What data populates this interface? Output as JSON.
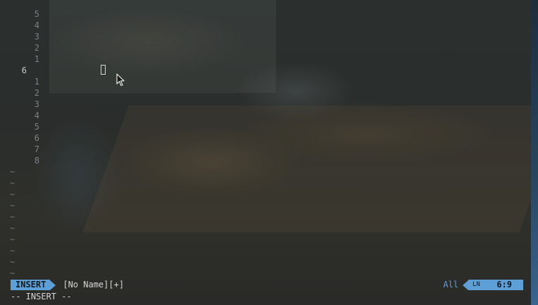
{
  "editor": {
    "line_numbers_above": [
      "5",
      "4",
      "3",
      "2",
      "1"
    ],
    "current_line_number": "6",
    "line_numbers_below": [
      "1",
      "2",
      "3",
      "4",
      "5",
      "6",
      "7",
      "8"
    ],
    "empty_line_markers": [
      "~",
      "~",
      "~",
      "~",
      "~",
      "~",
      "~",
      "~",
      "~",
      "~"
    ]
  },
  "statusline": {
    "mode": "INSERT",
    "filename": "[No Name][+]",
    "scroll_position": "All",
    "line_number_glyph": "LN",
    "cursor_position": "6:9"
  },
  "cmdline": {
    "message": "-- INSERT --"
  },
  "icons": {
    "mouse_pointer": "mouse-pointer-icon",
    "text_cursor": "text-cursor-icon"
  },
  "colors": {
    "accent": "#5f9fd7",
    "foreground": "#d4d6d8",
    "line_number": "#7c8084"
  }
}
